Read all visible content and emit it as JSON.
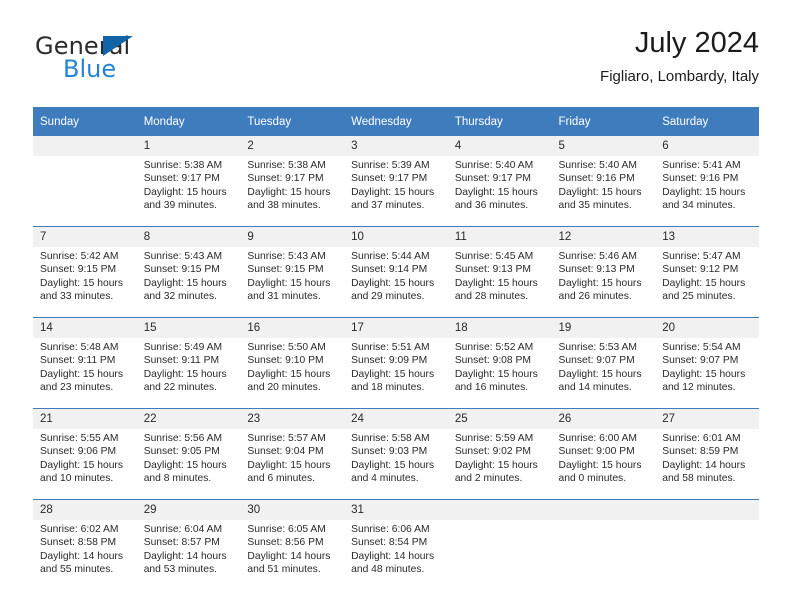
{
  "brand": {
    "name_part1": "General",
    "name_part2": "Blue",
    "color_dark": "#2b2b2b",
    "color_blue": "#2585d3",
    "triangle_color": "#1364a6"
  },
  "header": {
    "title": "July 2024",
    "subtitle": "Figliaro, Lombardy, Italy",
    "accent_color": "#3f7cbe",
    "daynum_band_color": "#f1f1f1"
  },
  "weekdays": [
    "Sunday",
    "Monday",
    "Tuesday",
    "Wednesday",
    "Thursday",
    "Friday",
    "Saturday"
  ],
  "labels": {
    "sunrise_prefix": "Sunrise:",
    "sunset_prefix": "Sunset:",
    "daylight_prefix": "Daylight:"
  },
  "weeks": [
    [
      {
        "day": "",
        "blank": true,
        "line1": "",
        "line2": "",
        "line3": "",
        "line4": ""
      },
      {
        "day": "1",
        "blank": false,
        "line1": "Sunrise: 5:38 AM",
        "line2": "Sunset: 9:17 PM",
        "line3": "Daylight: 15 hours",
        "line4": "and 39 minutes."
      },
      {
        "day": "2",
        "blank": false,
        "line1": "Sunrise: 5:38 AM",
        "line2": "Sunset: 9:17 PM",
        "line3": "Daylight: 15 hours",
        "line4": "and 38 minutes."
      },
      {
        "day": "3",
        "blank": false,
        "line1": "Sunrise: 5:39 AM",
        "line2": "Sunset: 9:17 PM",
        "line3": "Daylight: 15 hours",
        "line4": "and 37 minutes."
      },
      {
        "day": "4",
        "blank": false,
        "line1": "Sunrise: 5:40 AM",
        "line2": "Sunset: 9:17 PM",
        "line3": "Daylight: 15 hours",
        "line4": "and 36 minutes."
      },
      {
        "day": "5",
        "blank": false,
        "line1": "Sunrise: 5:40 AM",
        "line2": "Sunset: 9:16 PM",
        "line3": "Daylight: 15 hours",
        "line4": "and 35 minutes."
      },
      {
        "day": "6",
        "blank": false,
        "line1": "Sunrise: 5:41 AM",
        "line2": "Sunset: 9:16 PM",
        "line3": "Daylight: 15 hours",
        "line4": "and 34 minutes."
      }
    ],
    [
      {
        "day": "7",
        "blank": false,
        "line1": "Sunrise: 5:42 AM",
        "line2": "Sunset: 9:15 PM",
        "line3": "Daylight: 15 hours",
        "line4": "and 33 minutes."
      },
      {
        "day": "8",
        "blank": false,
        "line1": "Sunrise: 5:43 AM",
        "line2": "Sunset: 9:15 PM",
        "line3": "Daylight: 15 hours",
        "line4": "and 32 minutes."
      },
      {
        "day": "9",
        "blank": false,
        "line1": "Sunrise: 5:43 AM",
        "line2": "Sunset: 9:15 PM",
        "line3": "Daylight: 15 hours",
        "line4": "and 31 minutes."
      },
      {
        "day": "10",
        "blank": false,
        "line1": "Sunrise: 5:44 AM",
        "line2": "Sunset: 9:14 PM",
        "line3": "Daylight: 15 hours",
        "line4": "and 29 minutes."
      },
      {
        "day": "11",
        "blank": false,
        "line1": "Sunrise: 5:45 AM",
        "line2": "Sunset: 9:13 PM",
        "line3": "Daylight: 15 hours",
        "line4": "and 28 minutes."
      },
      {
        "day": "12",
        "blank": false,
        "line1": "Sunrise: 5:46 AM",
        "line2": "Sunset: 9:13 PM",
        "line3": "Daylight: 15 hours",
        "line4": "and 26 minutes."
      },
      {
        "day": "13",
        "blank": false,
        "line1": "Sunrise: 5:47 AM",
        "line2": "Sunset: 9:12 PM",
        "line3": "Daylight: 15 hours",
        "line4": "and 25 minutes."
      }
    ],
    [
      {
        "day": "14",
        "blank": false,
        "line1": "Sunrise: 5:48 AM",
        "line2": "Sunset: 9:11 PM",
        "line3": "Daylight: 15 hours",
        "line4": "and 23 minutes."
      },
      {
        "day": "15",
        "blank": false,
        "line1": "Sunrise: 5:49 AM",
        "line2": "Sunset: 9:11 PM",
        "line3": "Daylight: 15 hours",
        "line4": "and 22 minutes."
      },
      {
        "day": "16",
        "blank": false,
        "line1": "Sunrise: 5:50 AM",
        "line2": "Sunset: 9:10 PM",
        "line3": "Daylight: 15 hours",
        "line4": "and 20 minutes."
      },
      {
        "day": "17",
        "blank": false,
        "line1": "Sunrise: 5:51 AM",
        "line2": "Sunset: 9:09 PM",
        "line3": "Daylight: 15 hours",
        "line4": "and 18 minutes."
      },
      {
        "day": "18",
        "blank": false,
        "line1": "Sunrise: 5:52 AM",
        "line2": "Sunset: 9:08 PM",
        "line3": "Daylight: 15 hours",
        "line4": "and 16 minutes."
      },
      {
        "day": "19",
        "blank": false,
        "line1": "Sunrise: 5:53 AM",
        "line2": "Sunset: 9:07 PM",
        "line3": "Daylight: 15 hours",
        "line4": "and 14 minutes."
      },
      {
        "day": "20",
        "blank": false,
        "line1": "Sunrise: 5:54 AM",
        "line2": "Sunset: 9:07 PM",
        "line3": "Daylight: 15 hours",
        "line4": "and 12 minutes."
      }
    ],
    [
      {
        "day": "21",
        "blank": false,
        "line1": "Sunrise: 5:55 AM",
        "line2": "Sunset: 9:06 PM",
        "line3": "Daylight: 15 hours",
        "line4": "and 10 minutes."
      },
      {
        "day": "22",
        "blank": false,
        "line1": "Sunrise: 5:56 AM",
        "line2": "Sunset: 9:05 PM",
        "line3": "Daylight: 15 hours",
        "line4": "and 8 minutes."
      },
      {
        "day": "23",
        "blank": false,
        "line1": "Sunrise: 5:57 AM",
        "line2": "Sunset: 9:04 PM",
        "line3": "Daylight: 15 hours",
        "line4": "and 6 minutes."
      },
      {
        "day": "24",
        "blank": false,
        "line1": "Sunrise: 5:58 AM",
        "line2": "Sunset: 9:03 PM",
        "line3": "Daylight: 15 hours",
        "line4": "and 4 minutes."
      },
      {
        "day": "25",
        "blank": false,
        "line1": "Sunrise: 5:59 AM",
        "line2": "Sunset: 9:02 PM",
        "line3": "Daylight: 15 hours",
        "line4": "and 2 minutes."
      },
      {
        "day": "26",
        "blank": false,
        "line1": "Sunrise: 6:00 AM",
        "line2": "Sunset: 9:00 PM",
        "line3": "Daylight: 15 hours",
        "line4": "and 0 minutes."
      },
      {
        "day": "27",
        "blank": false,
        "line1": "Sunrise: 6:01 AM",
        "line2": "Sunset: 8:59 PM",
        "line3": "Daylight: 14 hours",
        "line4": "and 58 minutes."
      }
    ],
    [
      {
        "day": "28",
        "blank": false,
        "line1": "Sunrise: 6:02 AM",
        "line2": "Sunset: 8:58 PM",
        "line3": "Daylight: 14 hours",
        "line4": "and 55 minutes."
      },
      {
        "day": "29",
        "blank": false,
        "line1": "Sunrise: 6:04 AM",
        "line2": "Sunset: 8:57 PM",
        "line3": "Daylight: 14 hours",
        "line4": "and 53 minutes."
      },
      {
        "day": "30",
        "blank": false,
        "line1": "Sunrise: 6:05 AM",
        "line2": "Sunset: 8:56 PM",
        "line3": "Daylight: 14 hours",
        "line4": "and 51 minutes."
      },
      {
        "day": "31",
        "blank": false,
        "line1": "Sunrise: 6:06 AM",
        "line2": "Sunset: 8:54 PM",
        "line3": "Daylight: 14 hours",
        "line4": "and 48 minutes."
      },
      {
        "day": "",
        "blank": true,
        "line1": "",
        "line2": "",
        "line3": "",
        "line4": ""
      },
      {
        "day": "",
        "blank": true,
        "line1": "",
        "line2": "",
        "line3": "",
        "line4": ""
      },
      {
        "day": "",
        "blank": true,
        "line1": "",
        "line2": "",
        "line3": "",
        "line4": ""
      }
    ]
  ]
}
